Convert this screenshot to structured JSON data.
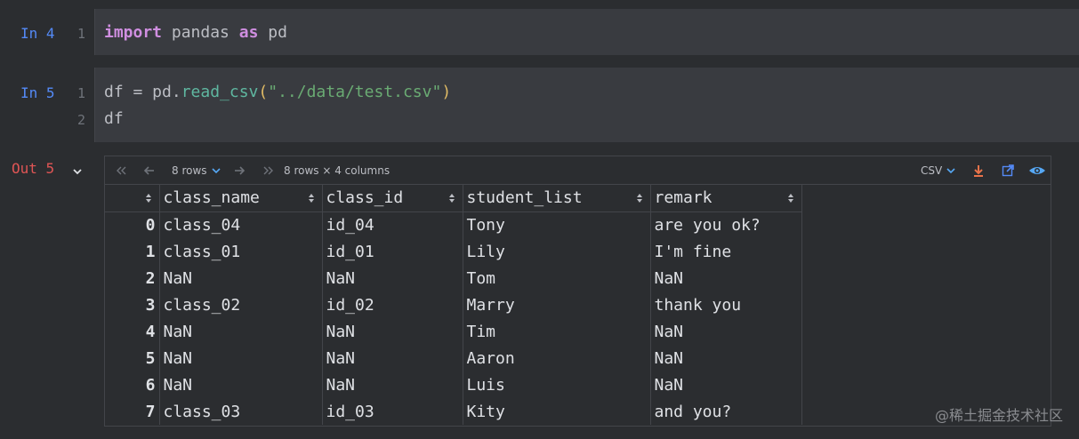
{
  "cells": [
    {
      "prompt": "In 4",
      "lines": [
        {
          "num": "1"
        }
      ]
    },
    {
      "prompt": "In 5",
      "lines": [
        {
          "num": "1"
        },
        {
          "num": "2",
          "text": "df"
        }
      ]
    }
  ],
  "code": {
    "import_kw": "import",
    "module": " pandas ",
    "as_kw": "as",
    "alias": " pd",
    "df_assign": "df = pd.",
    "fn_name": "read_csv",
    "open_paren": "(",
    "path_str": "\"../data/test.csv\"",
    "close_paren": ")"
  },
  "output": {
    "prompt": "Out 5",
    "toolbar": {
      "rows_select": "8 rows",
      "summary": "8 rows × 4 columns",
      "format_select": "CSV"
    },
    "columns": [
      "class_name",
      "class_id",
      "student_list",
      "remark"
    ],
    "rows": [
      {
        "index": "0",
        "class_name": "class_04",
        "class_id": "id_04",
        "student_list": "Tony",
        "remark": "are you ok?"
      },
      {
        "index": "1",
        "class_name": "class_01",
        "class_id": "id_01",
        "student_list": "Lily",
        "remark": "I'm fine"
      },
      {
        "index": "2",
        "class_name": "NaN",
        "class_id": "NaN",
        "student_list": "Tom",
        "remark": "NaN"
      },
      {
        "index": "3",
        "class_name": "class_02",
        "class_id": "id_02",
        "student_list": "Marry",
        "remark": "thank you"
      },
      {
        "index": "4",
        "class_name": "NaN",
        "class_id": "NaN",
        "student_list": "Tim",
        "remark": "NaN"
      },
      {
        "index": "5",
        "class_name": "NaN",
        "class_id": "NaN",
        "student_list": "Aaron",
        "remark": "NaN"
      },
      {
        "index": "6",
        "class_name": "NaN",
        "class_id": "NaN",
        "student_list": "Luis",
        "remark": "NaN"
      },
      {
        "index": "7",
        "class_name": "class_03",
        "class_id": "id_03",
        "student_list": "Kity",
        "remark": "and you?"
      }
    ]
  },
  "watermark": "@稀土掘金技术社区",
  "colors": {
    "background": "#2b2d30",
    "code_bg": "#393b40",
    "in_prompt": "#548af7",
    "out_prompt": "#e05555",
    "keyword": "#cf8ee0",
    "string": "#6aab73",
    "download_icon": "#e8734a",
    "link_icon": "#548af7",
    "eye_icon": "#56a8f5"
  },
  "icons": [
    "chevron-down-icon",
    "first-page-icon",
    "prev-page-icon",
    "next-page-icon",
    "last-page-icon",
    "download-icon",
    "open-in-new-icon",
    "eye-icon",
    "sort-icon"
  ]
}
